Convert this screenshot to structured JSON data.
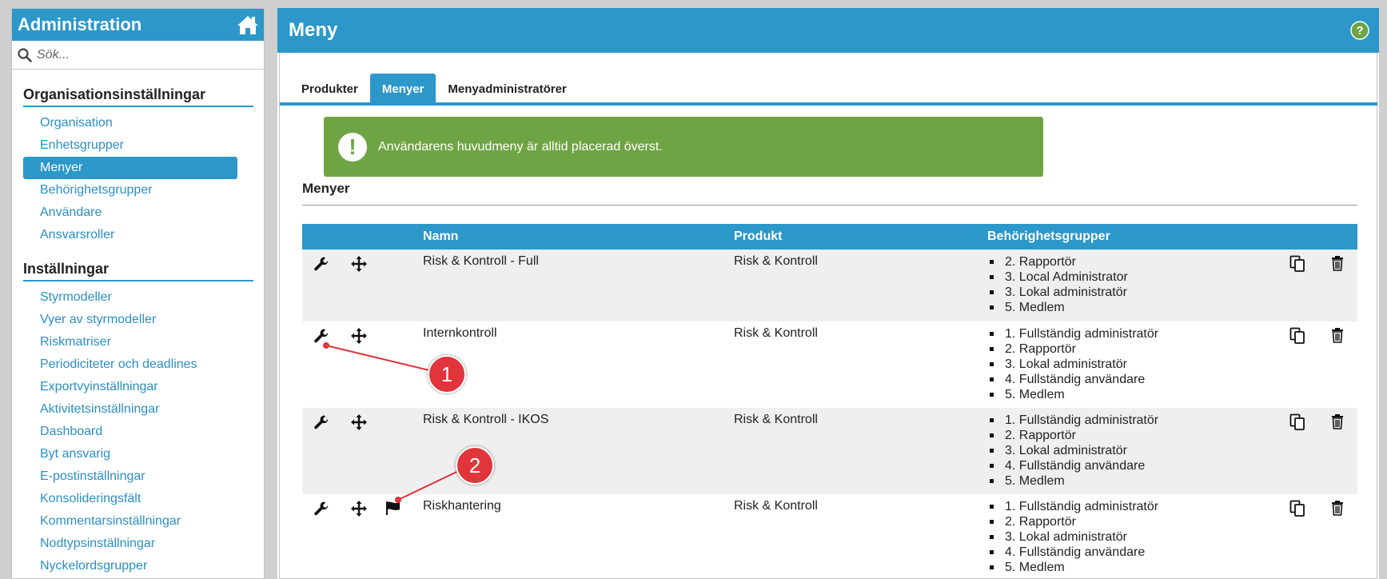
{
  "sidebar": {
    "title": "Administration",
    "home_icon": "home-icon",
    "search": {
      "placeholder": "Sök...",
      "icon": "search-icon"
    },
    "sections": [
      {
        "title": "Organisationsinställningar",
        "items": [
          "Organisation",
          "Enhetsgrupper",
          "Menyer",
          "Behörighetsgrupper",
          "Användare",
          "Ansvarsroller"
        ]
      },
      {
        "title": "Inställningar",
        "items": [
          "Styrmodeller",
          "Vyer av styrmodeller",
          "Riskmatriser",
          "Periodiciteter och deadlines",
          "Exportvyinställningar",
          "Aktivitetsinställningar",
          "Dashboard",
          "Byt ansvarig",
          "E-postinställningar",
          "Konsolideringsfält",
          "Kommentarsinställningar",
          "Nodtypsinställningar",
          "Nyckelordsgrupper"
        ]
      }
    ],
    "active_item": "Menyer"
  },
  "main": {
    "title": "Meny",
    "help_icon": "help-icon",
    "tabs": [
      {
        "label": "Produkter",
        "active": false
      },
      {
        "label": "Menyer",
        "active": true
      },
      {
        "label": "Menyadministratörer",
        "active": false
      }
    ],
    "notice": {
      "icon": "exclamation-icon",
      "text": "Användarens huvudmeny är alltid placerad överst."
    },
    "section_heading": "Menyer",
    "table": {
      "headers": {
        "name": "Namn",
        "product": "Produkt",
        "groups": "Behörighetsgrupper"
      },
      "rows": [
        {
          "name": "Risk & Kontroll - Full",
          "product": "Risk & Kontroll",
          "groups": [
            "2. Rapportör",
            "3. Local Administrator",
            "3. Lokal administratör",
            "5. Medlem"
          ],
          "flag": false
        },
        {
          "name": "Internkontroll",
          "product": "Risk & Kontroll",
          "groups": [
            "1. Fullständig administratör",
            "2. Rapportör",
            "3. Lokal administratör",
            "4. Fullständig användare",
            "5. Medlem"
          ],
          "flag": false
        },
        {
          "name": "Risk & Kontroll - IKOS",
          "product": "Risk & Kontroll",
          "groups": [
            "1. Fullständig administratör",
            "2. Rapportör",
            "3. Lokal administratör",
            "4. Fullständig användare",
            "5. Medlem"
          ],
          "flag": false
        },
        {
          "name": "Riskhantering",
          "product": "Risk & Kontroll",
          "groups": [
            "1. Fullständig administratör",
            "2. Rapportör",
            "3. Lokal administratör",
            "4. Fullständig användare",
            "5. Medlem"
          ],
          "flag": true
        }
      ]
    }
  },
  "annotations": [
    {
      "label": "1"
    },
    {
      "label": "2"
    }
  ],
  "colors": {
    "primary": "#2c97c9",
    "notice": "#6fa444",
    "callout": "#e0353b",
    "row_shade": "#efefef"
  }
}
